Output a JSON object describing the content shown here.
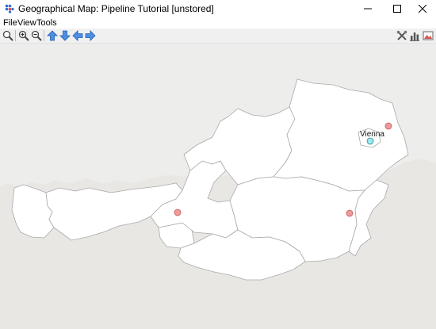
{
  "window": {
    "title": "Geographical Map: Pipeline Tutorial [unstored]",
    "app_icon": "dots-grid-icon",
    "controls": [
      "minimize-icon",
      "maximize-icon",
      "close-icon"
    ]
  },
  "menu": {
    "items": [
      {
        "label": "File"
      },
      {
        "label": "View"
      },
      {
        "label": "Tools"
      }
    ]
  },
  "toolbar": {
    "left_tools": [
      "zoom-tool-icon",
      "zoom-in-icon",
      "zoom-out-icon",
      "pan-up-icon",
      "pan-down-icon",
      "pan-left-icon",
      "pan-right-icon"
    ],
    "right_tools": [
      "tools-settings-icon",
      "chart-icon",
      "image-export-icon"
    ]
  },
  "map": {
    "city_label": "Vienna",
    "colors": {
      "background": "#ededeb",
      "land": "#ffffff",
      "border": "#a9a9a9",
      "marker_fill": "#ef9a9a",
      "marker_stroke": "#c75b5b",
      "city_marker_fill": "#9ee7ef",
      "city_marker_stroke": "#2f8f9a"
    }
  }
}
